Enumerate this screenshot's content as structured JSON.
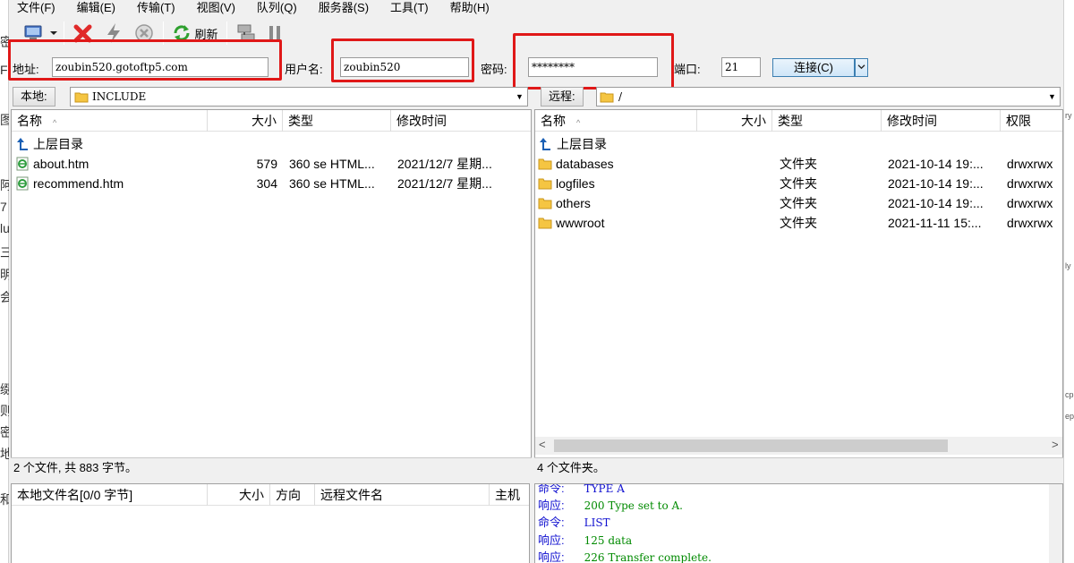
{
  "menu": [
    "文件(F)",
    "编辑(E)",
    "传输(T)",
    "视图(V)",
    "队列(Q)",
    "服务器(S)",
    "工具(T)",
    "帮助(H)"
  ],
  "toolbar": {
    "refresh_label": "刷新"
  },
  "address": {
    "host_label": "地址:",
    "host_value": "zoubin520.gotoftp5.com",
    "user_label": "用户名:",
    "user_value": "zoubin520",
    "pass_label": "密码:",
    "pass_value": "********",
    "port_label": "端口:",
    "port_value": "21",
    "connect_label": "连接(C)"
  },
  "local": {
    "path_label": "本地:",
    "path": "INCLUDE",
    "columns": [
      "名称",
      "大小",
      "类型",
      "修改时间"
    ],
    "parent_label": "上层目录",
    "files": [
      {
        "name": "about.htm",
        "size": "579",
        "type": "360 se HTML...",
        "modified": "2021/12/7 星期..."
      },
      {
        "name": "recommend.htm",
        "size": "304",
        "type": "360 se HTML...",
        "modified": "2021/12/7 星期..."
      }
    ],
    "status": "2 个文件, 共 883 字节。"
  },
  "remote": {
    "path_label": "远程:",
    "path": "/",
    "columns": [
      "名称",
      "大小",
      "类型",
      "修改时间",
      "权限"
    ],
    "parent_label": "上层目录",
    "folders": [
      {
        "name": "databases",
        "type": "文件夹",
        "modified": "2021-10-14 19:...",
        "perm": "drwxrwx"
      },
      {
        "name": "logfiles",
        "type": "文件夹",
        "modified": "2021-10-14 19:...",
        "perm": "drwxrwx"
      },
      {
        "name": "others",
        "type": "文件夹",
        "modified": "2021-10-14 19:...",
        "perm": "drwxrwx"
      },
      {
        "name": "wwwroot",
        "type": "文件夹",
        "modified": "2021-11-11 15:...",
        "perm": "drwxrwx"
      }
    ],
    "status": "4 个文件夹。"
  },
  "queue": {
    "columns": [
      "本地文件名[0/0 字节]",
      "大小",
      "方向",
      "远程文件名",
      "主机"
    ]
  },
  "log": [
    {
      "kind": "命令:",
      "text": "TYPE A",
      "cmd": true
    },
    {
      "kind": "响应:",
      "text": "200 Type set to A.",
      "cmd": false
    },
    {
      "kind": "命令:",
      "text": "LIST",
      "cmd": true
    },
    {
      "kind": "响应:",
      "text": "125 data",
      "cmd": false
    },
    {
      "kind": "响应:",
      "text": "226 Transfer complete.",
      "cmd": false
    }
  ],
  "background": {
    "left_fragments": [
      "密",
      "F",
      "图",
      "阿",
      "7",
      "lu",
      "三",
      "明",
      "会",
      "缀",
      "则",
      "密",
      "地",
      "和"
    ],
    "right_fragments": [
      "ry",
      "ly",
      "cp",
      "ep"
    ]
  },
  "colors": {
    "highlight": "#e01818",
    "command": "#1010d0",
    "response": "#008a00",
    "folder": "#f5c542"
  }
}
